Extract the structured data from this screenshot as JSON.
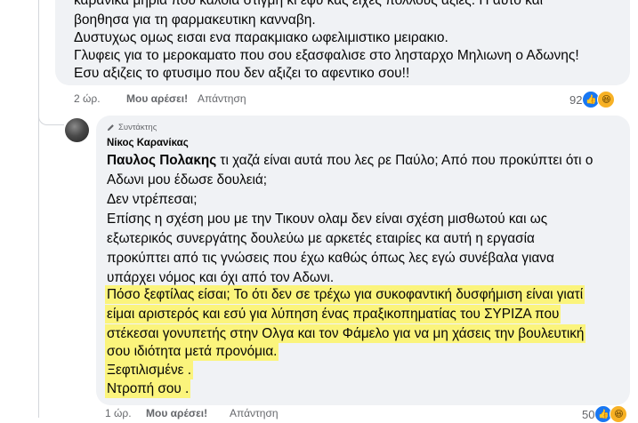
{
  "comment1": {
    "lines": [
      "καρανικα μηρια που καλοια στιγμη κι εφυ κας ειχες πολλους αξιες. Η αυτο και",
      "βοηθησα για τη φαρμακευτικη κανναβη.",
      "Δυστυχως ομως εισαι ενα παρακμιακο ωφελιμιστικο μειρακιο.",
      "Γλυφεις για το μεροκαματο που σου εξασφαλισε στο λησταρχο Μηλιωνη ο Αδωνης!",
      "Εσυ αξιζεις το φτυσιμο που δεν αξιζει το αφεντικο σου!!"
    ],
    "time": "2 ώρ.",
    "like_label": "Μου αρέσει!",
    "reply_label": "Απάντηση",
    "reaction_count": "92"
  },
  "comment2": {
    "badge": "Συντάκτης",
    "author": "Νίκος Καρανίκας",
    "mention": "Παυλος Πολακης",
    "first_line_rest": " τι χαζά είναι αυτά που λες ρε Παύλο; Από που προκύπτει ότι ο",
    "lines": [
      "Αδωνι μου έδωσε δουλειά;",
      "Δεν ντρέπεσαι;",
      "Επίσης η σχέση μου με την Τικουν ολαμ δεν είναι σχέση μισθωτού και ως",
      "εξωτερικός συνεργάτης δουλεύω με αρκετές εταιρίες κα αυτή η εργασία",
      "προκύπτει από τις γνώσεις που έχω καθώς όπως λες εγώ συνέβαλα γιανα",
      "υπάρχει νόμος και όχι από τον Αδωνι."
    ],
    "highlighted_lines": [
      "Πόσο ξεφτίλας είσαι; Το ότι δεν σε τρέχω για συκοφαντική δυσφήμιση είναι γιατί",
      "είμαι αριστερός και εσύ για λύπηση ένας πραξικοπηματίας του ΣΥΡΙΖΑ που",
      "στέκεσαι γονυπετής στην Ολγα και τον Φάμελο για να μη χάσεις την βουλευτική",
      "σου ιδιότητα μετά προνόμια.",
      "Ξεφτιλισμένε .",
      "Ντροπή σου ."
    ],
    "time": "1 ώρ.",
    "like_label": "Μου αρέσει!",
    "reply_label": "Απάντηση",
    "reaction_count": "50"
  },
  "colors": {
    "bubble": "#f0f2f5",
    "highlight": "#fbf47c",
    "like_blue": "#1877f2",
    "meta_gray": "#65676b"
  }
}
